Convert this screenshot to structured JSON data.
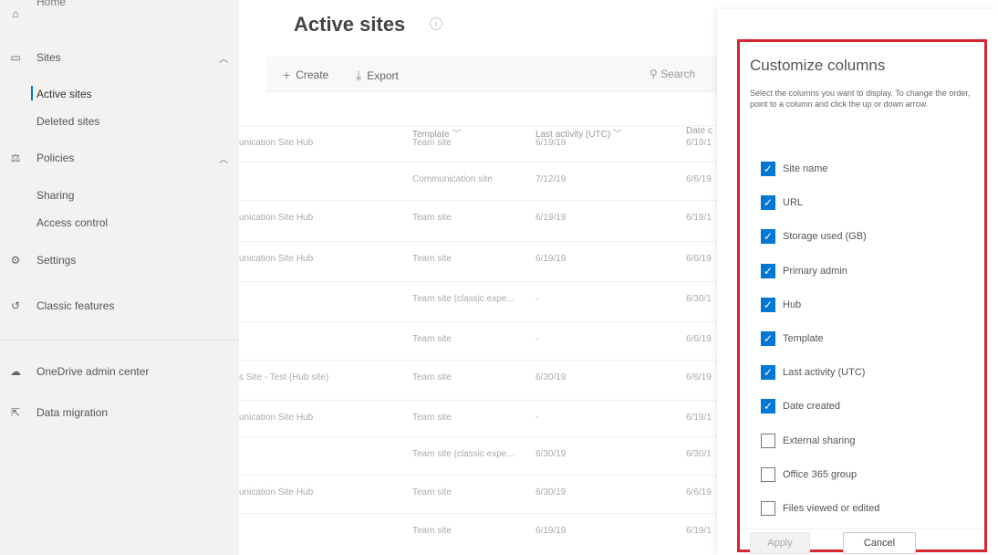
{
  "sidebar": {
    "home": "Home",
    "sites": "Sites",
    "active_sites": "Active sites",
    "deleted_sites": "Deleted sites",
    "policies": "Policies",
    "sharing": "Sharing",
    "access_control": "Access control",
    "settings": "Settings",
    "classic_features": "Classic features",
    "onedrive": "OneDrive admin center",
    "data_migration": "Data migration"
  },
  "main": {
    "title": "Active sites",
    "toolbar": {
      "create": "Create",
      "export": "Export",
      "search_placeholder": "Search"
    },
    "columns": {
      "template": "Template",
      "last_activity": "Last activity (UTC)",
      "date_created": "Date c"
    },
    "rows": [
      {
        "hub": "unication Site Hub",
        "template": "Team site",
        "activity": "6/19/19",
        "date": "6/19/1"
      },
      {
        "hub": "",
        "template": "Communication site",
        "activity": "7/12/19",
        "date": "6/6/19"
      },
      {
        "hub": "unication Site Hub",
        "template": "Team site",
        "activity": "6/19/19",
        "date": "6/19/1"
      },
      {
        "hub": "unication Site Hub",
        "template": "Team site",
        "activity": "6/19/19",
        "date": "6/6/19"
      },
      {
        "hub": "",
        "template": "Team site (classic expe...",
        "activity": "-",
        "date": "6/30/1"
      },
      {
        "hub": "",
        "template": "Team site",
        "activity": "-",
        "date": "6/6/19"
      },
      {
        "hub": "s Site - Test (Hub site)",
        "template": "Team site",
        "activity": "6/30/19",
        "date": "6/6/19"
      },
      {
        "hub": "unication Site Hub",
        "template": "Team site",
        "activity": "-",
        "date": "6/19/1"
      },
      {
        "hub": "",
        "template": "Team site (classic expe...",
        "activity": "6/30/19",
        "date": "6/30/1"
      },
      {
        "hub": "unication Site Hub",
        "template": "Team site",
        "activity": "6/30/19",
        "date": "6/6/19"
      },
      {
        "hub": "",
        "template": "Team site",
        "activity": "6/19/19",
        "date": "6/19/1"
      }
    ]
  },
  "panel": {
    "title": "Customize columns",
    "description": "Select the columns you want to display. To change the order, point to a column and click the up or down arrow.",
    "columns": [
      {
        "label": "Site name",
        "checked": true
      },
      {
        "label": "URL",
        "checked": true
      },
      {
        "label": "Storage used (GB)",
        "checked": true
      },
      {
        "label": "Primary admin",
        "checked": true
      },
      {
        "label": "Hub",
        "checked": true
      },
      {
        "label": "Template",
        "checked": true
      },
      {
        "label": "Last activity (UTC)",
        "checked": true
      },
      {
        "label": "Date created",
        "checked": true
      },
      {
        "label": "External sharing",
        "checked": false
      },
      {
        "label": "Office 365 group",
        "checked": false
      },
      {
        "label": "Files viewed or edited",
        "checked": false
      }
    ],
    "apply": "Apply",
    "cancel": "Cancel"
  },
  "colors": {
    "accent": "#0078d4",
    "highlight": "#d7262d"
  }
}
